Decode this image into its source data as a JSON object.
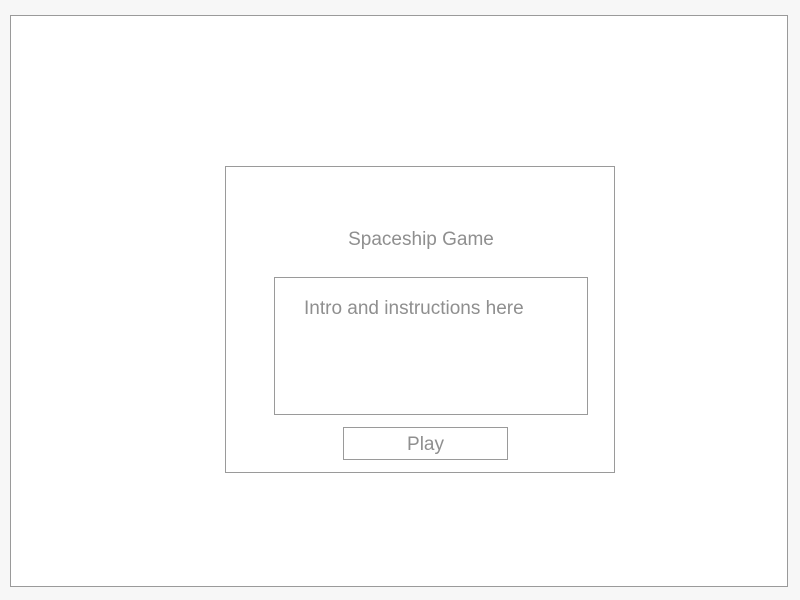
{
  "dialog": {
    "title": "Spaceship Game",
    "intro_text": "Intro and instructions here",
    "play_label": "Play"
  },
  "colors": {
    "background": "#f7f7f7",
    "panel": "#ffffff",
    "border": "#9a9a9a",
    "text": "#8f8f8f"
  }
}
